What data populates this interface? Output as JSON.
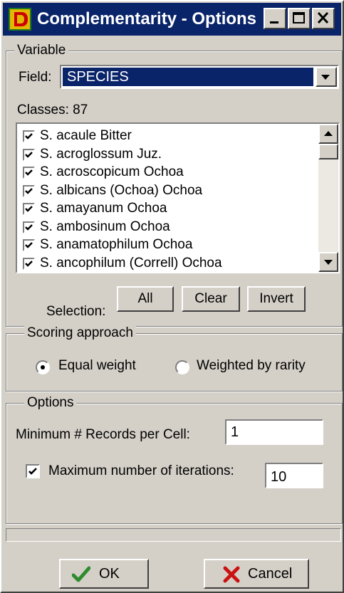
{
  "window": {
    "title": "Complementarity - Options",
    "app_icon": "d-logo-icon",
    "controls": [
      "minimize-icon",
      "maximize-icon",
      "close-icon"
    ]
  },
  "variable": {
    "legend": "Variable",
    "field_label": "Field:",
    "field_value": "SPECIES",
    "classes_label": "Classes: 87",
    "items": [
      {
        "label": "S. acaule Bitter",
        "checked": true
      },
      {
        "label": "S. acroglossum Juz.",
        "checked": true
      },
      {
        "label": "S. acroscopicum Ochoa",
        "checked": true
      },
      {
        "label": "S. albicans (Ochoa) Ochoa",
        "checked": true
      },
      {
        "label": "S. amayanum Ochoa",
        "checked": true
      },
      {
        "label": "S. ambosinum Ochoa",
        "checked": true
      },
      {
        "label": "S. anamatophilum Ochoa",
        "checked": true
      },
      {
        "label": "S. ancophilum (Correll) Ochoa",
        "checked": true
      }
    ],
    "selection_label": "Selection:",
    "all_label": "All",
    "clear_label": "Clear",
    "invert_label": "Invert"
  },
  "scoring": {
    "legend": "Scoring approach",
    "options": [
      {
        "label": "Equal weight",
        "selected": true
      },
      {
        "label": "Weighted by rarity",
        "selected": false
      }
    ]
  },
  "options": {
    "legend": "Options",
    "min_records_label": "Minimum # Records per Cell:",
    "min_records_value": "1",
    "max_iterations_label": "Maximum number of iterations:",
    "max_iterations_checked": true,
    "max_iterations_value": "10"
  },
  "footer": {
    "ok_label": "OK",
    "ok_icon": "checkmark-icon",
    "cancel_label": "Cancel",
    "cancel_icon": "x-mark-icon"
  },
  "colors": {
    "titlebar": "#0a246a",
    "face": "#d4d0c8",
    "selection": "#0a246a",
    "ok_check": "#2e8b2e",
    "cancel_x": "#cc1111"
  }
}
